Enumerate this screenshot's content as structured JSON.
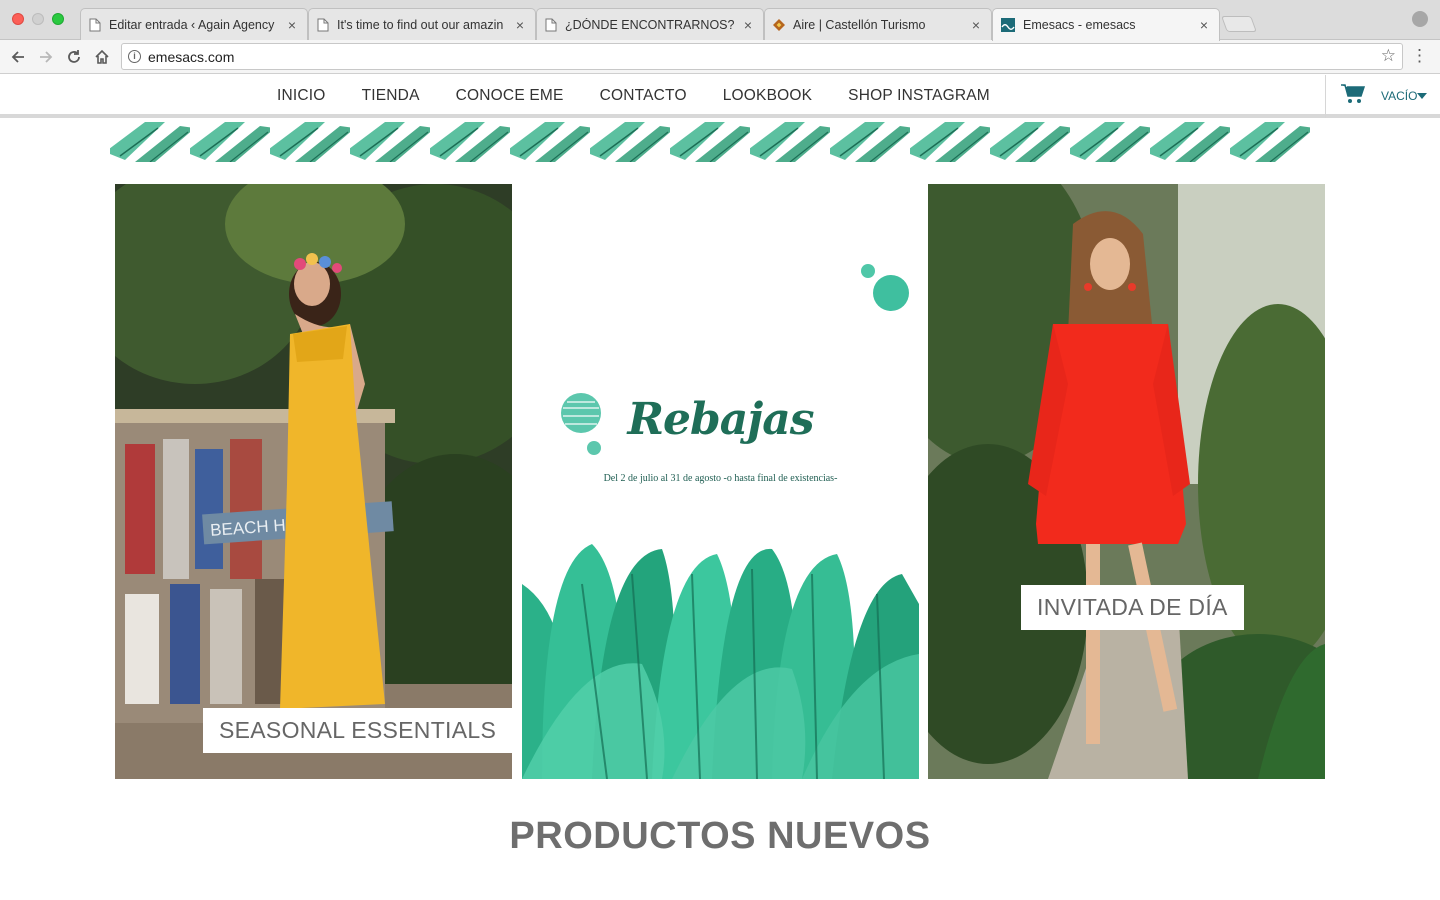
{
  "browser": {
    "tabs": [
      {
        "title": "Editar entrada ‹ Again Agency",
        "close": "×"
      },
      {
        "title": "It's time to find out our amazin",
        "close": "×"
      },
      {
        "title": "¿DÓNDE ENCONTRARNOS? - I",
        "close": "×"
      },
      {
        "title": "Aire | Castellón Turismo",
        "close": "×"
      },
      {
        "title": "Emesacs - emesacs",
        "close": "×"
      }
    ],
    "url": "emesacs.com",
    "back_icon": "back-arrow-icon",
    "forward_icon": "forward-arrow-icon",
    "reload_icon": "reload-icon",
    "home_icon": "home-icon"
  },
  "site": {
    "menu": [
      "INICIO",
      "TIENDA",
      "CONOCE EME",
      "CONTACTO",
      "LOOKBOOK",
      "SHOP INSTAGRAM"
    ],
    "cart_label": "VACÍO",
    "accent_color": "#1c6b78"
  },
  "tiles": {
    "left_caption": "SEASONAL ESSENTIALS",
    "mid_title": "Rebajas",
    "mid_subtitle": "Del 2 de julio al 31 de agosto -o hasta final de existencias-",
    "right_caption": "INVITADA DE DÍA",
    "leaf_color": "#2aa88a"
  },
  "section_title": "PRODUCTOS NUEVOS"
}
